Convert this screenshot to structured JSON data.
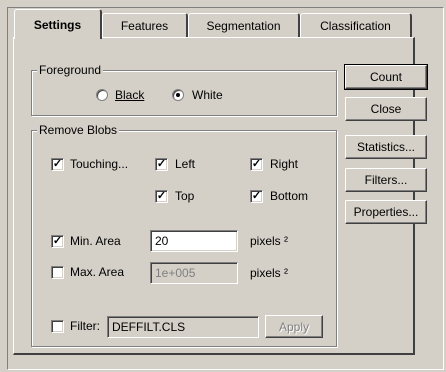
{
  "tabs": [
    {
      "label": "Settings",
      "active": true
    },
    {
      "label": "Features",
      "active": false
    },
    {
      "label": "Segmentation",
      "active": false
    },
    {
      "label": "Classification",
      "active": false
    }
  ],
  "foreground": {
    "title": "Foreground",
    "options": [
      {
        "label": "Black",
        "selected": false
      },
      {
        "label": "White",
        "selected": true
      }
    ]
  },
  "remove_blobs": {
    "title": "Remove Blobs",
    "touching": {
      "label": "Touching...",
      "checked": true
    },
    "left": {
      "label": "Left",
      "checked": true
    },
    "right": {
      "label": "Right",
      "checked": true
    },
    "top": {
      "label": "Top",
      "checked": true
    },
    "bottom": {
      "label": "Bottom",
      "checked": true
    },
    "min_area": {
      "label": "Min. Area",
      "checked": true,
      "value": "20",
      "unit": "pixels ²"
    },
    "max_area": {
      "label": "Max. Area",
      "checked": false,
      "value": "1e+005",
      "unit": "pixels ²"
    },
    "filter": {
      "label": "Filter:",
      "checked": false,
      "value": "DEFFILT.CLS",
      "apply_label": "Apply"
    }
  },
  "buttons": {
    "count": "Count",
    "close": "Close",
    "statistics": "Statistics...",
    "filters": "Filters...",
    "properties": "Properties..."
  },
  "check_glyph": "✓"
}
